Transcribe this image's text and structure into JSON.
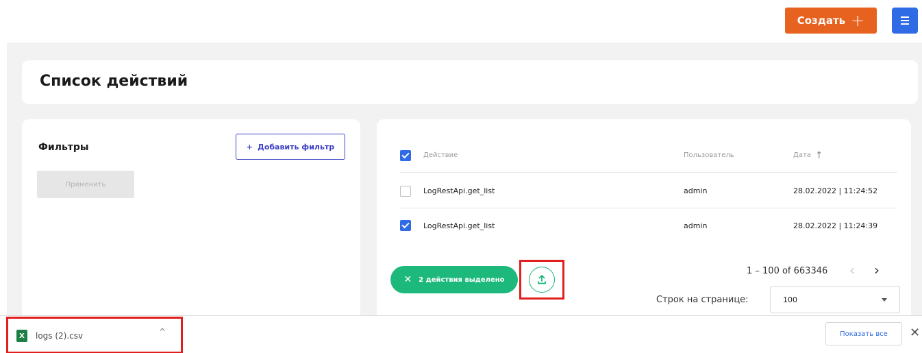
{
  "header": {
    "create_label": "Создать",
    "create_icon": "+",
    "menu_icon": "hamburger-icon"
  },
  "page": {
    "title": "Список действий"
  },
  "filters": {
    "title": "Фильтры",
    "add_filter_label": "Добавить фильтр",
    "add_filter_icon": "+",
    "apply_label": "Применить"
  },
  "table": {
    "columns": [
      "Действие",
      "Пользователь",
      "Дата"
    ],
    "header_checked": true,
    "rows": [
      {
        "action": "LogRestApi.get_list",
        "user": "admin",
        "date": "28.02.2022 | 11:24:52",
        "checked": false
      },
      {
        "action": "LogRestApi.get_list",
        "user": "admin",
        "date": "28.02.2022 | 11:24:39",
        "checked": true
      }
    ]
  },
  "selection": {
    "label": "2 действия выделено",
    "close_icon": "✕",
    "export_icon": "upload-icon"
  },
  "pagination": {
    "range_text": "1 – 100 of 663346",
    "prev_icon": "‹",
    "next_icon": "›",
    "rows_per_page_label": "Строк на странице:",
    "rows_per_page_value": "100"
  },
  "download_bar": {
    "file_name": "logs (2).csv",
    "file_icon_letter": "X",
    "chevron": "^",
    "show_all_label": "Показать все",
    "close_icon": "✕"
  },
  "colors": {
    "accent_orange": "#e8621f",
    "accent_blue": "#2f6be4",
    "accent_green": "#1db87b",
    "highlight_red": "#e11f1f"
  }
}
